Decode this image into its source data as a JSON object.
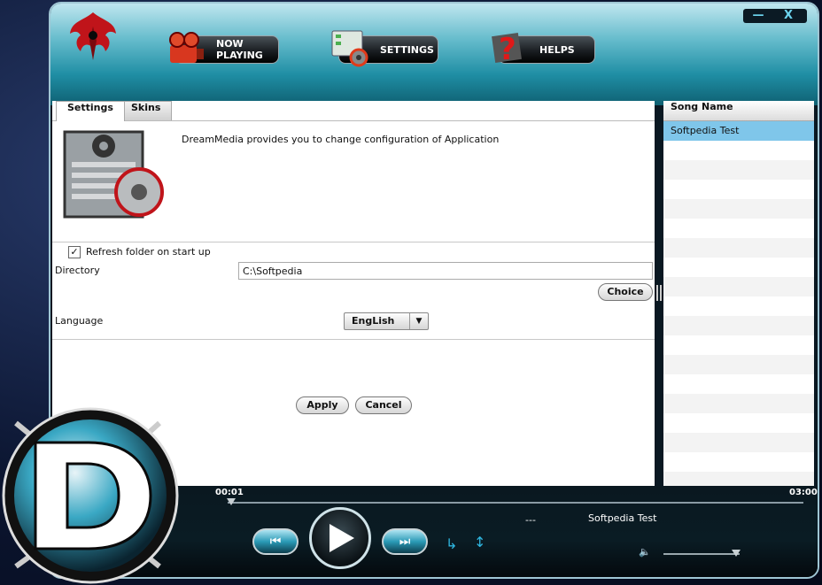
{
  "nav": {
    "now_playing": "NOW PLAYING",
    "settings": "SETTINGS",
    "helps": "HELPS"
  },
  "window_buttons": {
    "minimize": "—",
    "close": "X"
  },
  "tabs": [
    {
      "label": "Settings",
      "active": true
    },
    {
      "label": "Skins",
      "active": false
    }
  ],
  "settings": {
    "description": "DreamMedia provides you to change configuration of Application",
    "refresh_label": "Refresh folder on start up",
    "refresh_checked": true,
    "directory_label": "Directory",
    "directory_value": "C:\\Softpedia",
    "choice_label": "Choice",
    "language_label": "Language",
    "language_value": "EngLish",
    "apply_label": "Apply",
    "cancel_label": "Cancel"
  },
  "playlist": {
    "header": "Song Name",
    "songs": [
      "Softpedia Test"
    ],
    "selected_index": 0
  },
  "player": {
    "current_time": "00:01",
    "total_time": "03:00",
    "progress": 0.0056,
    "now_playing_dash": "---",
    "now_playing_title": "Softpedia Test",
    "volume_level": 0.95,
    "prev_icon": "prev-icon",
    "play_icon": "play-icon",
    "next_icon": "next-icon",
    "repeat_icon": "repeat-icon",
    "shuffle_icon": "shuffle-icon",
    "volume_icon": "speaker-icon"
  },
  "colors": {
    "accent": "#1f8ea4",
    "selection": "#7fc6ea",
    "logo_red": "#c0141a"
  }
}
